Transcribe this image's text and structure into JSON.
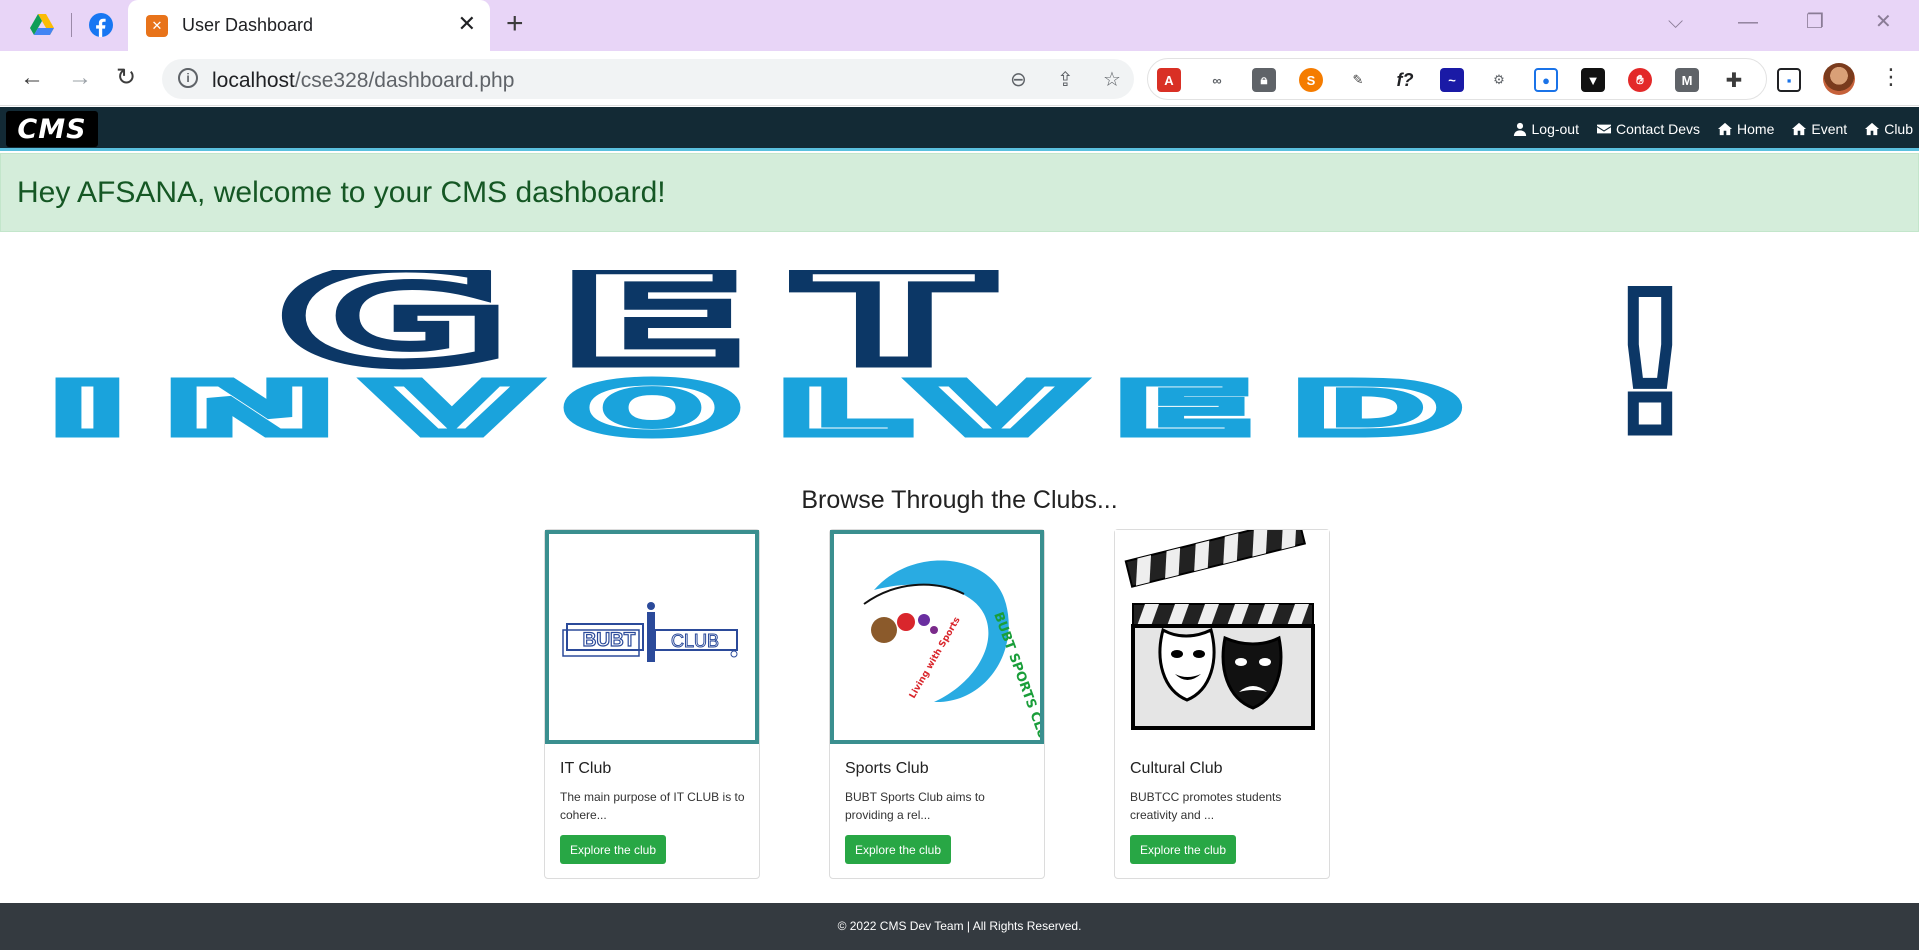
{
  "browser": {
    "tab_title": "User Dashboard",
    "url_host": "localhost",
    "url_path": "/cse328/dashboard.php"
  },
  "site": {
    "logo_text": "CMS",
    "nav": [
      {
        "label": "Log-out",
        "icon": "user-icon"
      },
      {
        "label": "Contact Devs",
        "icon": "envelope-icon"
      },
      {
        "label": "Home",
        "icon": "home-icon"
      },
      {
        "label": "Event",
        "icon": "home-icon"
      },
      {
        "label": "Club",
        "icon": "home-icon"
      }
    ]
  },
  "welcome": "Hey AFSANA, welcome to your CMS dashboard!",
  "banner": {
    "line1": "GET",
    "line2": "INVOLVED",
    "mark": "!"
  },
  "browse_heading": "Browse Through the Clubs...",
  "clubs": [
    {
      "title": "IT Club",
      "description": "The main purpose of IT CLUB is to cohere...",
      "button": "Explore the club",
      "logo_text": "BUBT CLUB"
    },
    {
      "title": "Sports Club",
      "description": "BUBT Sports Club aims to providing a rel...",
      "button": "Explore the club",
      "logo_text": "BUBT SPORTS CLUB",
      "logo_subtext": "Living with Sports"
    },
    {
      "title": "Cultural Club",
      "description": "BUBTCC promotes students creativity and ...",
      "button": "Explore the club"
    }
  ],
  "footer": "© 2022 CMS Dev Team | All Rights Reserved.",
  "colors": {
    "nav_bg": "#132a35",
    "alert_bg": "#d4edda",
    "alert_text": "#155724",
    "button": "#28a745",
    "footer_bg": "#343a40"
  }
}
